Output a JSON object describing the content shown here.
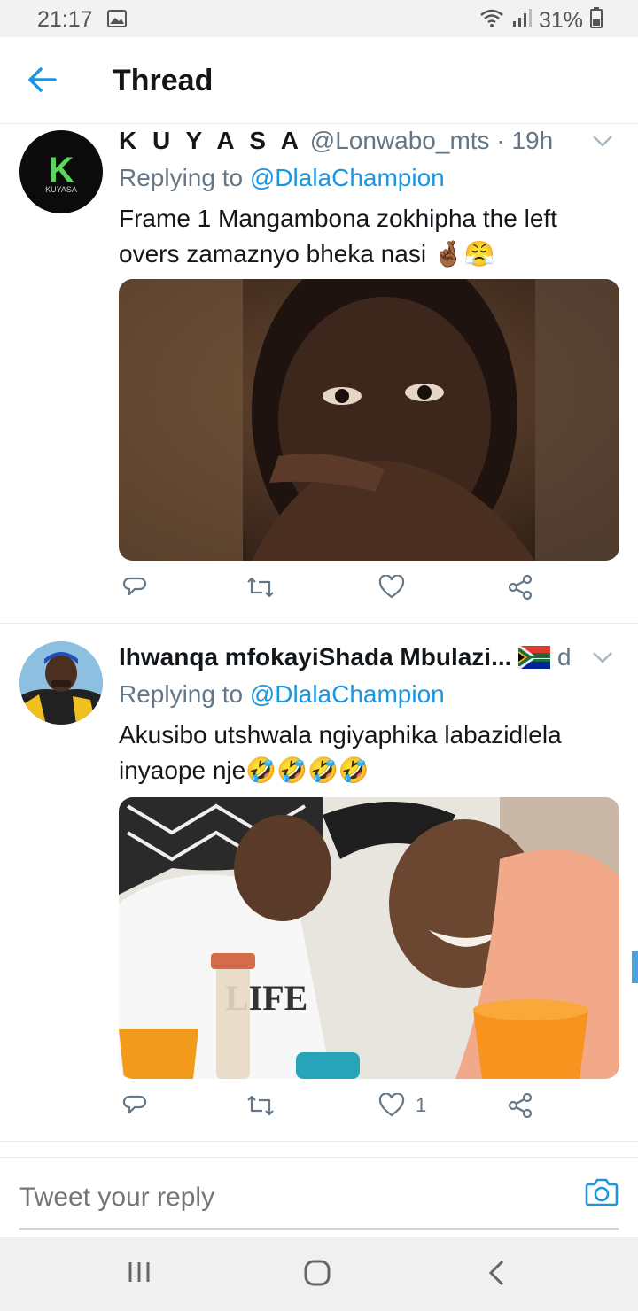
{
  "status_bar": {
    "time": "21:17",
    "battery": "31%"
  },
  "app_bar": {
    "title": "Thread"
  },
  "tweets": [
    {
      "name": "K U Y A S A",
      "handle": "@Lonwabo_mts",
      "separator": "·",
      "age": "19h",
      "replying_prefix": "Replying to",
      "replying_to": "@DlalaChampion",
      "text_line1": "Frame 1 Mangambona zokhipha the left",
      "text_line2": "overs zamaznyo bheka nasi",
      "emojis": "🤞🏾😤",
      "avatar_letter": "K",
      "avatar_caption": "KUYASA",
      "likes": ""
    },
    {
      "name": "Ihwanqa mfokayiShada Mbulazi...",
      "age": "d",
      "replying_prefix": "Replying to",
      "replying_to": "@DlalaChampion",
      "text_line1": "Akusibo utshwala ngiyaphika labazidlela",
      "text_line2": "inyaope nje",
      "emojis": "🤣🤣🤣🤣",
      "shirt_text": "LIFE",
      "likes": "1"
    }
  ],
  "reply_bar": {
    "placeholder": "Tweet your reply"
  },
  "colors": {
    "accent": "#1b95e0",
    "secondary_text": "#657786",
    "divider": "#e6ecf0"
  }
}
